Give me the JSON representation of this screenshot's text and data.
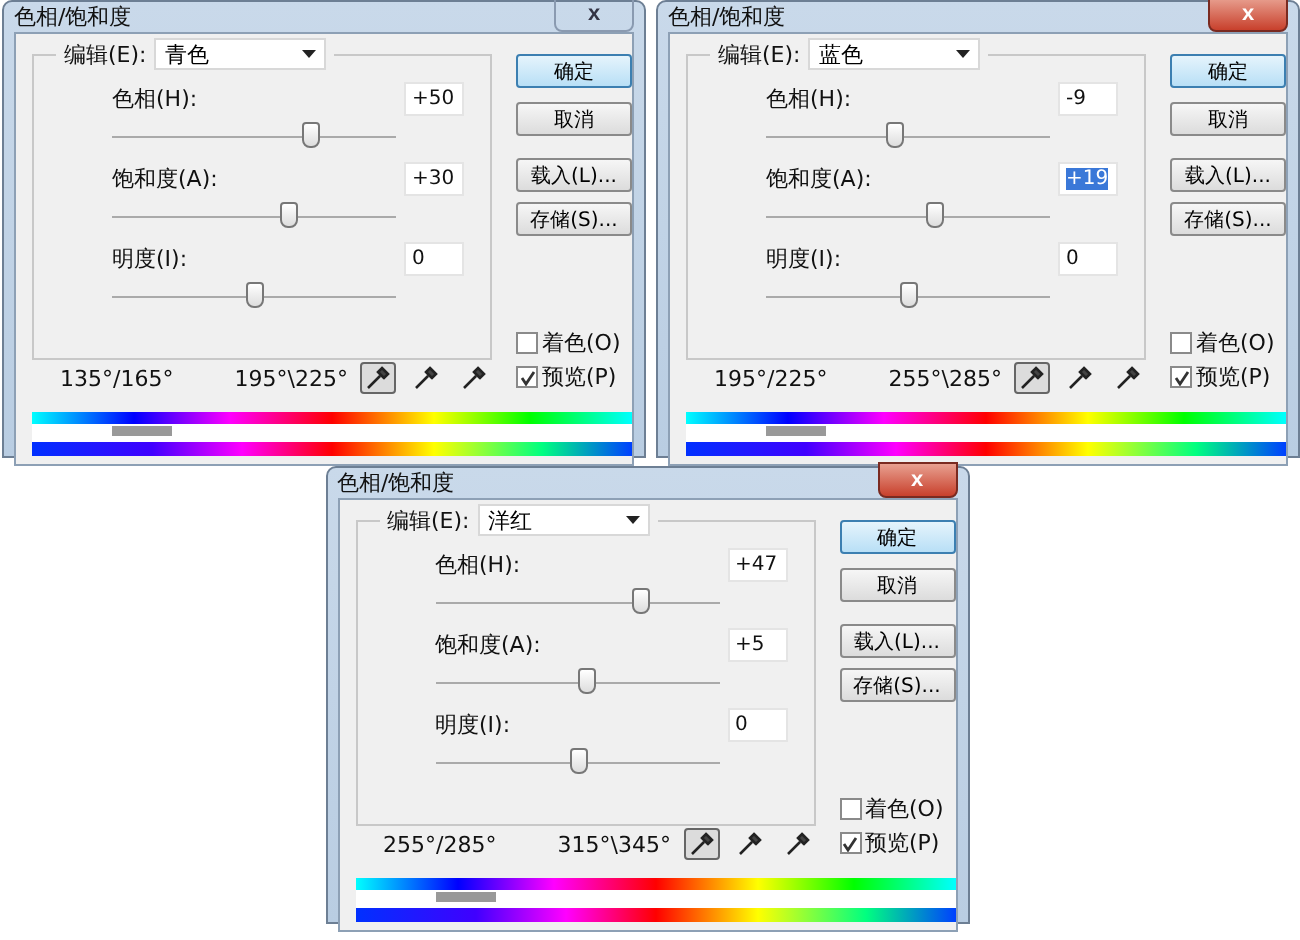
{
  "dialogs": [
    {
      "title": "色相/饱和度",
      "close_active": false,
      "edit_label": "编辑(E):",
      "edit_value": "青色",
      "close": "x",
      "sliders": [
        {
          "label": "色相(H):",
          "value": "+50",
          "selected": false,
          "level": 0.7
        },
        {
          "label": "饱和度(A):",
          "value": "+30",
          "selected": false,
          "level": 0.62
        },
        {
          "label": "明度(I):",
          "value": "0",
          "selected": false,
          "level": 0.5
        }
      ],
      "buttons": [
        "确定",
        "取消",
        "载入(L)...",
        "存储(S)..."
      ],
      "range_left": "135°/165°",
      "range_right": "195°\\225°",
      "tools": [
        {
          "selected": true
        },
        {
          "selected": false
        },
        {
          "selected": false
        }
      ],
      "checkboxes": [
        {
          "label": "着色(O)",
          "checked": false
        },
        {
          "label": "预览(P)",
          "checked": true
        }
      ]
    },
    {
      "title": "色相/饱和度",
      "close_active": true,
      "edit_label": "编辑(E):",
      "edit_value": "蓝色",
      "close": "x",
      "sliders": [
        {
          "label": "色相(H):",
          "value": "-9",
          "selected": false,
          "level": 0.45
        },
        {
          "label": "饱和度(A):",
          "value": "+19",
          "selected": true,
          "level": 0.59
        },
        {
          "label": "明度(I):",
          "value": "0",
          "selected": false,
          "level": 0.5
        }
      ],
      "buttons": [
        "确定",
        "取消",
        "载入(L)...",
        "存储(S)..."
      ],
      "range_left": "195°/225°",
      "range_right": "255°\\285°",
      "tools": [
        {
          "selected": true
        },
        {
          "selected": false
        },
        {
          "selected": false
        }
      ],
      "checkboxes": [
        {
          "label": "着色(O)",
          "checked": false
        },
        {
          "label": "预览(P)",
          "checked": true
        }
      ]
    },
    {
      "title": "色相/饱和度",
      "close_active": true,
      "edit_label": "编辑(E):",
      "edit_value": "洋红",
      "close": "x",
      "sliders": [
        {
          "label": "色相(H):",
          "value": "+47",
          "selected": false,
          "level": 0.72
        },
        {
          "label": "饱和度(A):",
          "value": "+5",
          "selected": false,
          "level": 0.53
        },
        {
          "label": "明度(I):",
          "value": "0",
          "selected": false,
          "level": 0.5
        }
      ],
      "buttons": [
        "确定",
        "取消",
        "载入(L)...",
        "存储(S)..."
      ],
      "range_left": "255°/285°",
      "range_right": "315°\\345°",
      "tools": [
        {
          "selected": true
        },
        {
          "selected": false
        },
        {
          "selected": false
        }
      ],
      "checkboxes": [
        {
          "label": "着色(O)",
          "checked": false
        },
        {
          "label": "预览(P)",
          "checked": true
        }
      ]
    }
  ]
}
